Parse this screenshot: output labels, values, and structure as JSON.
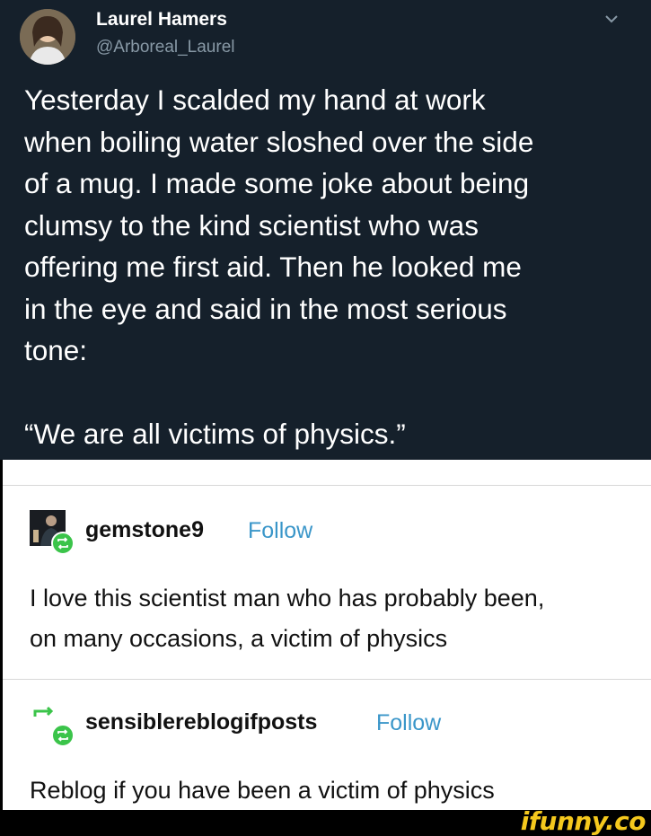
{
  "tweet": {
    "author_name": "Laurel Hamers",
    "author_handle": "@Arboreal_Laurel",
    "text": "Yesterday I scalded my hand at work\nwhen boiling water sloshed over the side\nof a mug. I made some joke about being\nclumsy to the kind scientist who was\noffering me first aid. Then he looked me\nin the eye and said in the most serious\ntone:",
    "quote": "“We are all victims of physics.”",
    "icons": {
      "avatar": "user-avatar",
      "menu": "chevron-down-icon"
    },
    "colors": {
      "background": "#15202b",
      "text": "#ffffff",
      "handle": "#8899a6"
    }
  },
  "posts": [
    {
      "blog": "gemstone9",
      "follow_label": "Follow",
      "body": "I love this scientist man who has probably been,\non many occasions, a victim of physics",
      "icons": {
        "avatar": "blog-avatar",
        "badge": "reblog-icon"
      }
    },
    {
      "blog": "sensiblereblogifposts",
      "follow_label": "Follow",
      "body": "Reblog if you have been a victim of physics",
      "icons": {
        "avatar": "reblog-icon",
        "badge": "reblog-icon"
      }
    }
  ],
  "colors": {
    "follow": "#3a96c9",
    "reblog_badge": "#3bc44a"
  },
  "watermark": "ifunny.co"
}
